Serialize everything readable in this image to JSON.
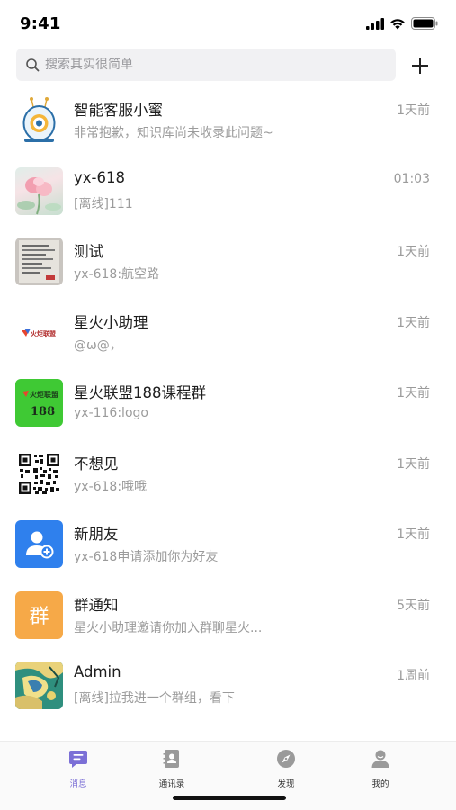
{
  "status": {
    "time": "9:41"
  },
  "search": {
    "placeholder": "搜索其实很简单"
  },
  "conversations": [
    {
      "title": "智能客服小蜜",
      "preview": "非常抱歉，知识库尚未收录此问题~",
      "time": "1天前",
      "avatar": "robot-avatar"
    },
    {
      "title": "yx-618",
      "preview": "[离线]111",
      "time": "01:03",
      "avatar": "flower-photo-avatar"
    },
    {
      "title": "测试",
      "preview": "yx-618:航空路",
      "time": "1天前",
      "avatar": "document-photo-avatar"
    },
    {
      "title": "星火小助理",
      "preview": "@ω@，",
      "time": "1天前",
      "avatar": "logo-avatar",
      "avatar_text": "火炬联盟"
    },
    {
      "title": "星火联盟188课程群",
      "preview": "yx-116:logo",
      "time": "1天前",
      "avatar": "group-logo-avatar",
      "avatar_text_1": "火炬联盟",
      "avatar_text_2": "188"
    },
    {
      "title": "不想见",
      "preview": "yx-618:哦哦",
      "time": "1天前",
      "avatar": "qr-code-avatar"
    },
    {
      "title": "新朋友",
      "preview": "yx-618申请添加你为好友",
      "time": "1天前",
      "avatar": "add-friend-icon"
    },
    {
      "title": "群通知",
      "preview": "星火小助理邀请你加入群聊星火...",
      "time": "5天前",
      "avatar": "group-notice-icon",
      "avatar_text": "群"
    },
    {
      "title": "Admin",
      "preview": "[离线]拉我进一个群组，看下",
      "time": "1周前",
      "avatar": "painting-avatar"
    }
  ],
  "tabs": [
    {
      "label": "消息",
      "icon": "chat-icon",
      "active": true
    },
    {
      "label": "通讯录",
      "icon": "contacts-icon",
      "active": false
    },
    {
      "label": "发现",
      "icon": "compass-icon",
      "active": false
    },
    {
      "label": "我的",
      "icon": "profile-icon",
      "active": false
    }
  ],
  "colors": {
    "accent": "#7b6fd6",
    "new_friend": "#2f80ed",
    "group_notice": "#f6a948",
    "group_logo_bg": "#3fc934"
  }
}
